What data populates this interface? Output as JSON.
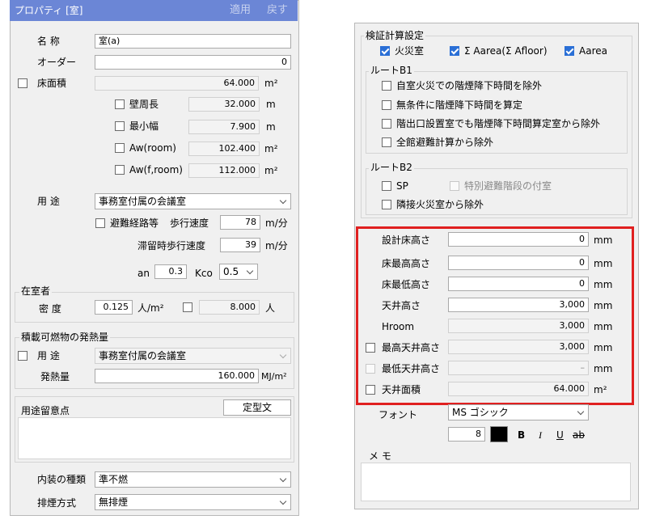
{
  "left": {
    "title": "プロパティ [室]",
    "apply": "適用",
    "back": "戻す",
    "name_label": "名 称",
    "name_value": "室(a)",
    "order_label": "オーダー",
    "order_value": "0",
    "floor_area_label": "床面積",
    "floor_area_value": "64.000",
    "floor_area_unit": "m²",
    "wall_len_label": "壁周長",
    "wall_len_value": "32.000",
    "wall_len_unit": "m",
    "min_width_label": "最小幅",
    "min_width_value": "7.900",
    "min_width_unit": "m",
    "aw_room_label": "Aw(room)",
    "aw_room_value": "102.400",
    "aw_room_unit": "m²",
    "aw_froom_label": "Aw(f,room)",
    "aw_froom_value": "112.000",
    "aw_froom_unit": "m²",
    "use_label": "用 途",
    "use_value": "事務室付属の会議室",
    "evac_label": "避難経路等",
    "walk_speed_label": "歩行速度",
    "walk_speed_value": "78",
    "walk_speed_unit": "m/分",
    "stay_speed_label": "滞留時歩行速度",
    "stay_speed_value": "39",
    "stay_speed_unit": "m/分",
    "an_label": "an",
    "an_value": "0.3",
    "kco_label": "Kco",
    "kco_value": "0.5",
    "occupants_group": "在室者",
    "density_label": "密 度",
    "density_value": "0.125",
    "density_unit": "人/m²",
    "persons_value": "8.000",
    "persons_unit": "人",
    "fuel_group": "積載可燃物の発熱量",
    "fuel_use_label": "用 途",
    "fuel_use_value": "事務室付属の会議室",
    "heat_label": "発熱量",
    "heat_value": "160.000",
    "heat_unit": "MJ/m²",
    "notes_label": "用途留意点",
    "template_button": "定型文",
    "interior_label": "内装の種類",
    "interior_value": "準不燃",
    "smoke_label": "排煙方式",
    "smoke_value": "無排煙"
  },
  "right": {
    "verify_group": "検証計算設定",
    "fire_room": "火災室",
    "sum_aarea": "Σ Aarea(Σ Afloor)",
    "aarea": "Aarea",
    "route_b1": "ルートB1",
    "b1_items": [
      "自室火災での階煙降下時間を除外",
      "無条件に階煙降下時間を算定",
      "階出口設置室でも階煙降下時間算定室から除外",
      "全館避難計算から除外"
    ],
    "route_b2": "ルートB2",
    "sp": "SP",
    "special_stairs": "特別避難階段の付室",
    "adjacent_exclude": "隣接火災室から除外",
    "design_floor_label": "設計床高さ",
    "design_floor_value": "0",
    "floor_max_label": "床最高高さ",
    "floor_max_value": "0",
    "floor_min_label": "床最低高さ",
    "floor_min_value": "0",
    "ceiling_label": "天井高さ",
    "ceiling_value": "3,000",
    "hroom_label": "Hroom",
    "hroom_value": "3,000",
    "ceil_max_label": "最高天井高さ",
    "ceil_max_value": "3,000",
    "ceil_min_label": "最低天井高さ",
    "ceil_min_value": "–",
    "ceil_area_label": "天井面積",
    "ceil_area_value": "64.000",
    "unit_mm": "mm",
    "unit_m2": "m²",
    "font_label": "フォント",
    "font_value": "MS ゴシック",
    "font_size": "8",
    "bold": "B",
    "italic": "I",
    "underline": "U",
    "strike": "ab",
    "memo_label": "メ モ"
  },
  "colors": {
    "header": "#6b86d6",
    "highlight": "#e02020",
    "checkbox_on": "#2a6fd6"
  }
}
